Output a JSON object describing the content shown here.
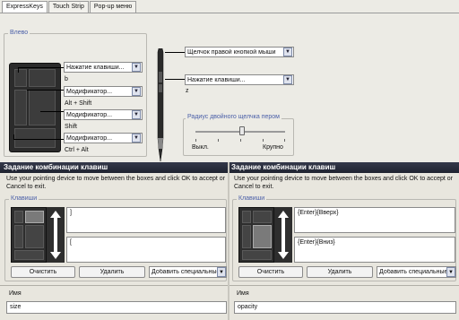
{
  "tabs": [
    "ExpressKeys",
    "Touch Strip",
    "Pop-up меню"
  ],
  "expresskeys": {
    "group_label": "Влево",
    "rows": [
      {
        "combo": "Нажатие клавиши...",
        "caption": "b"
      },
      {
        "combo": "Модификатор...",
        "caption": "Alt + Shift"
      },
      {
        "combo": "Модификатор...",
        "caption": "Shift"
      },
      {
        "combo": "Модификатор...",
        "caption": "Ctrl + Alt"
      }
    ]
  },
  "pen": {
    "upper_button": "Щелчок правой кнопкой мыши",
    "lower_button": "Нажатие клавиши...",
    "lower_caption": "z",
    "slider": {
      "title": "Радиус двойного щелчка пером",
      "min_label": "Выкл.",
      "max_label": "Крупно",
      "value_fraction": 0.52
    }
  },
  "dialogs": [
    {
      "title": "Задание комбинации клавиш",
      "instructions": "Use your pointing device to move between the boxes and click OK to accept or Cancel to exit.",
      "keys_label": "Клавиши",
      "upper_keystroke": "]",
      "lower_keystroke": "[",
      "clear_label": "Очистить",
      "delete_label": "Удалить",
      "add_special_label": "Добавить специальные",
      "name_label": "Имя",
      "name_value": "size"
    },
    {
      "title": "Задание комбинации клавиш",
      "instructions": "Use your pointing device to move between the boxes and click OK to accept or Cancel to exit.",
      "keys_label": "Клавиши",
      "upper_keystroke": "{Enter}{Вверх}",
      "lower_keystroke": "{Enter}{Вниз}",
      "clear_label": "Очистить",
      "delete_label": "Удалить",
      "add_special_label": "Добавить специальные",
      "name_label": "Имя",
      "name_value": "opacity"
    }
  ]
}
